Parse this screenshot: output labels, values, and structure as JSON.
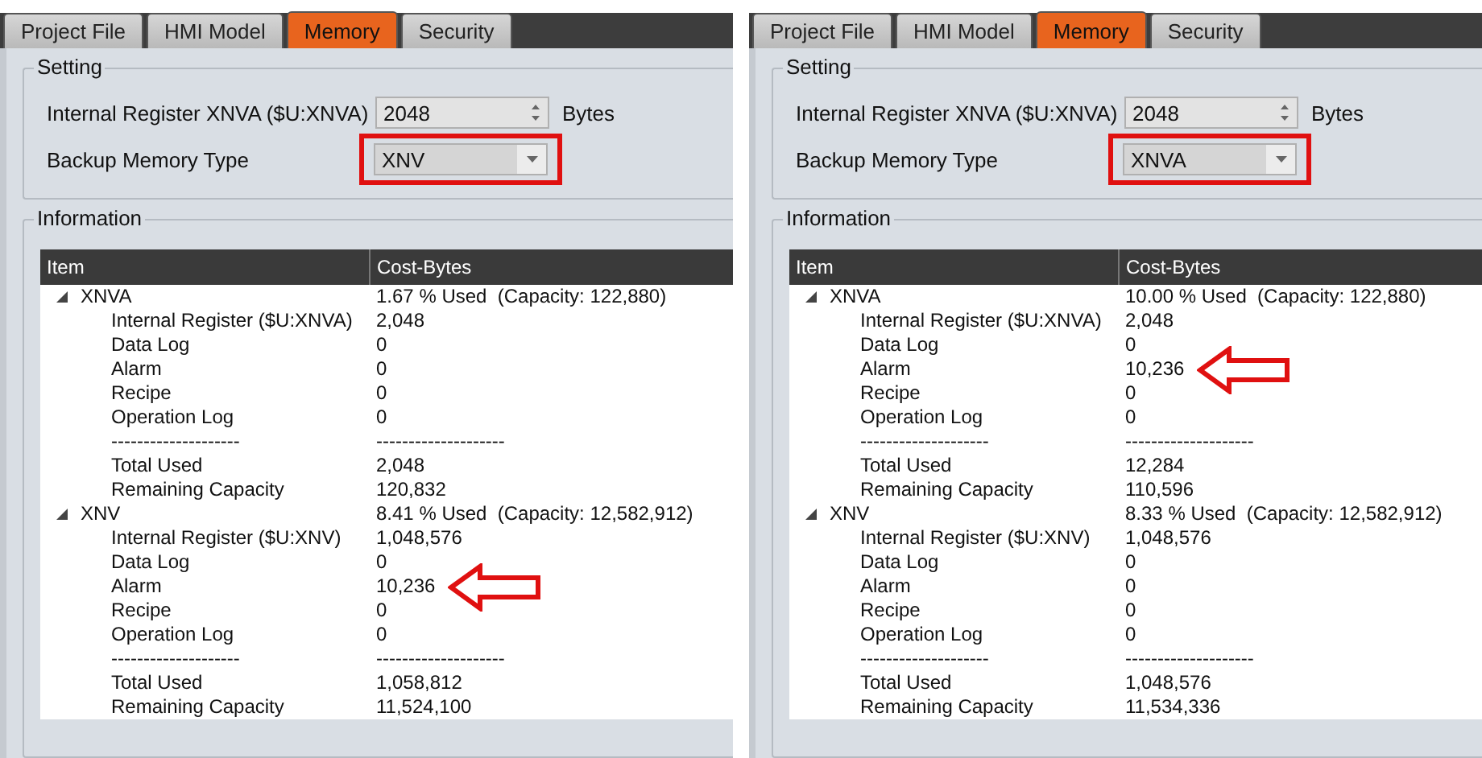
{
  "panels": [
    {
      "tabs": [
        {
          "label": "Project File",
          "selected": false
        },
        {
          "label": "HMI Model",
          "selected": false
        },
        {
          "label": "Memory",
          "selected": true
        },
        {
          "label": "Security",
          "selected": false
        }
      ],
      "setting": {
        "title": "Setting",
        "register_label": "Internal Register XNVA ($U:XNVA)",
        "register_value": "2048",
        "unit": "Bytes",
        "backup_label": "Backup Memory Type",
        "backup_value": "XNV",
        "highlighted": true
      },
      "information": {
        "title": "Information",
        "columns": [
          "Item",
          "Cost-Bytes"
        ],
        "groups": [
          {
            "name": "XNVA",
            "summary": "1.67 % Used  (Capacity: 122,880)",
            "expanded": true,
            "rows": [
              {
                "item": "Internal Register ($U:XNVA)",
                "cost": "2,048",
                "callout": false
              },
              {
                "item": "Data Log",
                "cost": "0",
                "callout": false
              },
              {
                "item": "Alarm",
                "cost": "0",
                "callout": false
              },
              {
                "item": "Recipe",
                "cost": "0",
                "callout": false
              },
              {
                "item": "Operation Log",
                "cost": "0",
                "callout": false
              },
              {
                "item": "--------------------",
                "cost": "--------------------",
                "callout": false
              },
              {
                "item": "Total Used",
                "cost": "2,048",
                "callout": false
              },
              {
                "item": "Remaining Capacity",
                "cost": "120,832",
                "callout": false
              }
            ]
          },
          {
            "name": "XNV",
            "summary": "8.41 % Used  (Capacity: 12,582,912)",
            "expanded": true,
            "rows": [
              {
                "item": "Internal Register ($U:XNV)",
                "cost": "1,048,576",
                "callout": false
              },
              {
                "item": "Data Log",
                "cost": "0",
                "callout": false
              },
              {
                "item": "Alarm",
                "cost": "10,236",
                "callout": true
              },
              {
                "item": "Recipe",
                "cost": "0",
                "callout": false
              },
              {
                "item": "Operation Log",
                "cost": "0",
                "callout": false
              },
              {
                "item": "--------------------",
                "cost": "--------------------",
                "callout": false
              },
              {
                "item": "Total Used",
                "cost": "1,058,812",
                "callout": false
              },
              {
                "item": "Remaining Capacity",
                "cost": "11,524,100",
                "callout": false
              }
            ]
          }
        ]
      }
    },
    {
      "tabs": [
        {
          "label": "Project File",
          "selected": false
        },
        {
          "label": "HMI Model",
          "selected": false
        },
        {
          "label": "Memory",
          "selected": true
        },
        {
          "label": "Security",
          "selected": false
        }
      ],
      "setting": {
        "title": "Setting",
        "register_label": "Internal Register XNVA ($U:XNVA)",
        "register_value": "2048",
        "unit": "Bytes",
        "backup_label": "Backup Memory Type",
        "backup_value": "XNVA",
        "highlighted": true
      },
      "information": {
        "title": "Information",
        "columns": [
          "Item",
          "Cost-Bytes"
        ],
        "groups": [
          {
            "name": "XNVA",
            "summary": "10.00 % Used  (Capacity: 122,880)",
            "expanded": true,
            "rows": [
              {
                "item": "Internal Register ($U:XNVA)",
                "cost": "2,048",
                "callout": false
              },
              {
                "item": "Data Log",
                "cost": "0",
                "callout": false
              },
              {
                "item": "Alarm",
                "cost": "10,236",
                "callout": true
              },
              {
                "item": "Recipe",
                "cost": "0",
                "callout": false
              },
              {
                "item": "Operation Log",
                "cost": "0",
                "callout": false
              },
              {
                "item": "--------------------",
                "cost": "--------------------",
                "callout": false
              },
              {
                "item": "Total Used",
                "cost": "12,284",
                "callout": false
              },
              {
                "item": "Remaining Capacity",
                "cost": "110,596",
                "callout": false
              }
            ]
          },
          {
            "name": "XNV",
            "summary": "8.33 % Used  (Capacity: 12,582,912)",
            "expanded": true,
            "rows": [
              {
                "item": "Internal Register ($U:XNV)",
                "cost": "1,048,576",
                "callout": false
              },
              {
                "item": "Data Log",
                "cost": "0",
                "callout": false
              },
              {
                "item": "Alarm",
                "cost": "0",
                "callout": false
              },
              {
                "item": "Recipe",
                "cost": "0",
                "callout": false
              },
              {
                "item": "Operation Log",
                "cost": "0",
                "callout": false
              },
              {
                "item": "--------------------",
                "cost": "--------------------",
                "callout": false
              },
              {
                "item": "Total Used",
                "cost": "1,048,576",
                "callout": false
              },
              {
                "item": "Remaining Capacity",
                "cost": "11,534,336",
                "callout": false
              }
            ]
          }
        ]
      }
    }
  ]
}
